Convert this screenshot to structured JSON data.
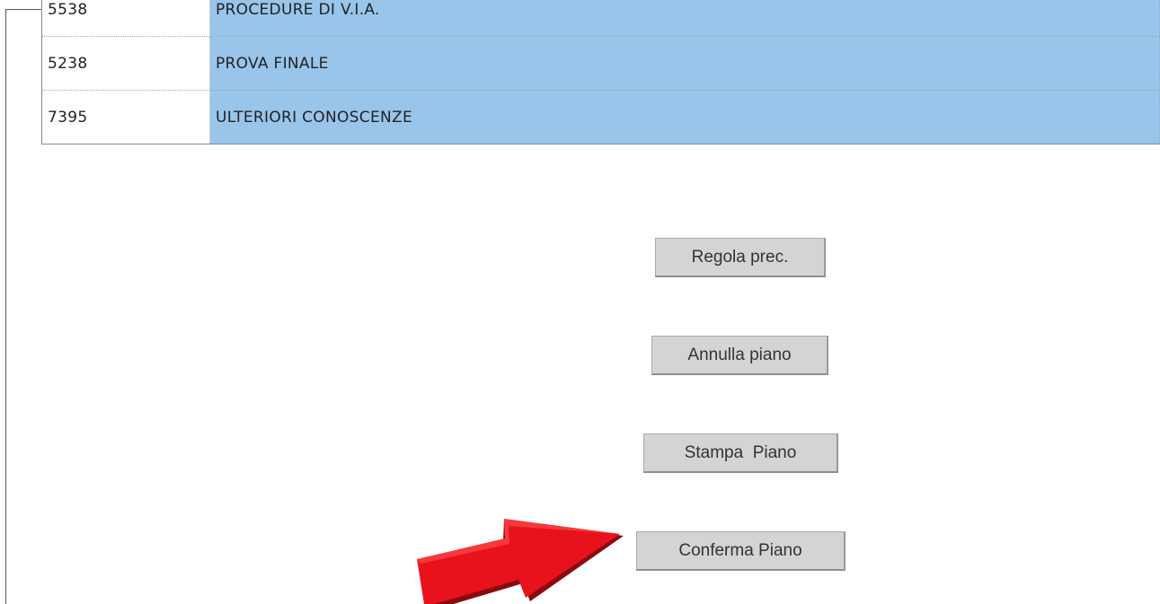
{
  "table": {
    "rows": [
      {
        "code": "5538",
        "name": "PROCEDURE DI V.I.A."
      },
      {
        "code": "5238",
        "name": "PROVA FINALE"
      },
      {
        "code": "7395",
        "name": "ULTERIORI CONOSCENZE"
      }
    ]
  },
  "buttons": {
    "regola_prec": "Regola prec.",
    "annulla_piano": "Annulla piano",
    "stampa_piano": "Stampa  Piano",
    "conferma_piano": "Conferma Piano"
  },
  "colors": {
    "row_highlight": "#99c5ea",
    "button_bg": "#d4d4d4",
    "arrow": "#e8121c"
  },
  "icons": {
    "pointer_arrow": "red-arrow-icon"
  }
}
